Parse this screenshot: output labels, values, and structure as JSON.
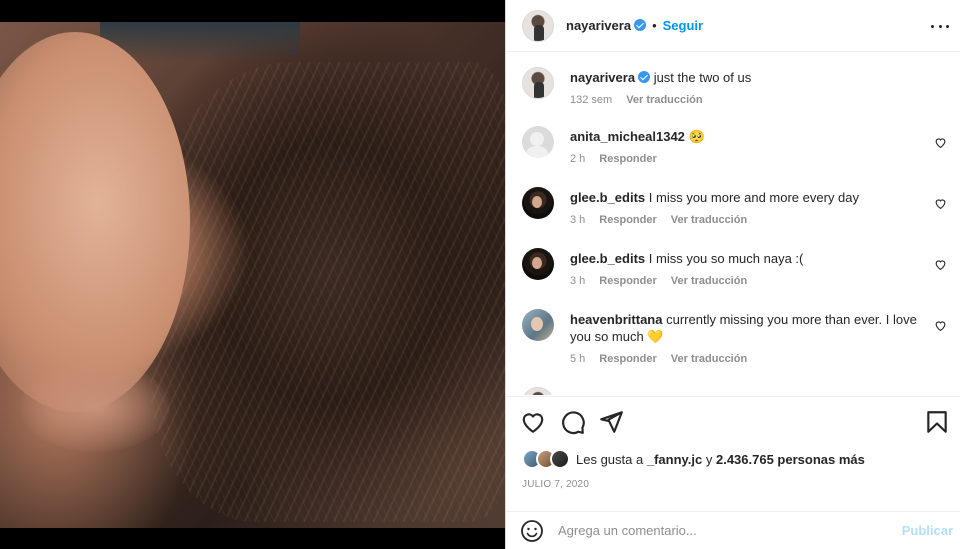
{
  "post": {
    "username": "nayarivera",
    "follow_label": "Seguir",
    "separator": "•",
    "caption": "just the two of us",
    "caption_time": "132 sem",
    "translate_label": "Ver traducción"
  },
  "comments": [
    {
      "username": "anita_micheal1342",
      "text": "🥺",
      "time": "2 h",
      "reply": "Responder",
      "translate": ""
    },
    {
      "username": "glee.b_edits",
      "text": "I miss you more and more every day",
      "time": "3 h",
      "reply": "Responder",
      "translate": "Ver traducción"
    },
    {
      "username": "glee.b_edits",
      "text": "I miss you so much naya :(",
      "time": "3 h",
      "reply": "Responder",
      "translate": "Ver traducción"
    },
    {
      "username": "heavenbrittana",
      "text": "currently missing you more than ever. I love you so much 💛",
      "time": "5 h",
      "reply": "Responder",
      "translate": "Ver traducción"
    }
  ],
  "likes": {
    "prefix": "Les gusta a",
    "user": "_fanny.jc",
    "middle": "y",
    "count": "2.436.765 personas más"
  },
  "date": "JULIO 7, 2020",
  "add_comment": {
    "placeholder": "Agrega un comentario...",
    "publish_label": "Publicar"
  },
  "icons": {
    "heart": "heart-icon",
    "comment": "comment-icon",
    "share": "share-icon",
    "save": "bookmark-icon",
    "more": "more-icon",
    "emoji": "emoji-icon"
  }
}
